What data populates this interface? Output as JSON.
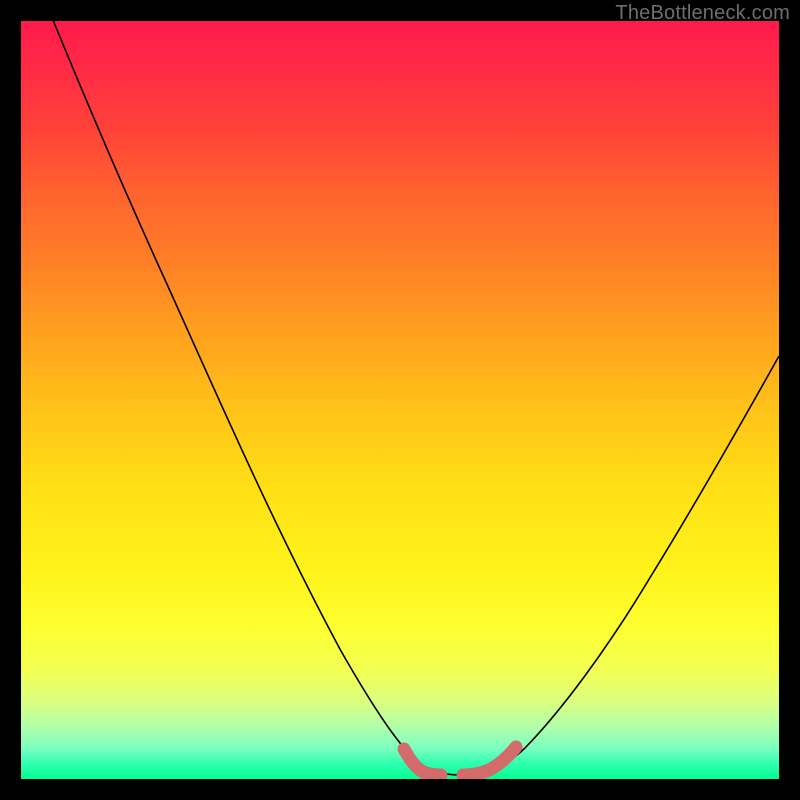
{
  "watermark": "TheBottleneck.com",
  "chart_data": {
    "type": "line",
    "title": "",
    "xlabel": "",
    "ylabel": "",
    "xlim": [
      0,
      100
    ],
    "ylim": [
      0,
      100
    ],
    "grid": false,
    "series": [
      {
        "name": "bottleneck-curve",
        "x": [
          0,
          5,
          10,
          15,
          20,
          25,
          30,
          35,
          40,
          45,
          50,
          52,
          54,
          56,
          58,
          60,
          62,
          65,
          70,
          75,
          80,
          85,
          90,
          95,
          100
        ],
        "values": [
          110,
          98,
          87,
          76,
          66,
          56,
          47,
          38,
          29,
          20,
          10,
          5,
          1,
          0,
          0,
          1,
          3,
          6,
          12,
          18,
          25,
          32,
          39,
          47,
          55
        ]
      }
    ],
    "highlight": {
      "name": "optimum-band",
      "x_range": [
        51,
        63
      ],
      "color": "#d36b6b"
    },
    "background_gradient_stops": [
      {
        "pos": 0.0,
        "color": "#ff1a4c"
      },
      {
        "pos": 0.5,
        "color": "#ffc518"
      },
      {
        "pos": 0.8,
        "color": "#fdff30"
      },
      {
        "pos": 1.0,
        "color": "#00ff8f"
      }
    ]
  }
}
